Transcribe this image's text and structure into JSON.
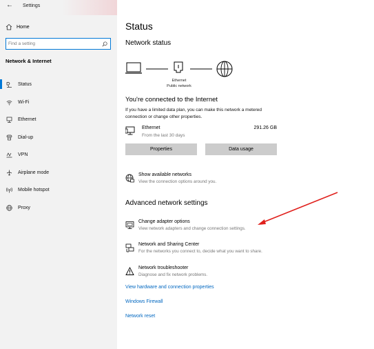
{
  "window": {
    "title": "Settings",
    "back_glyph": "←"
  },
  "sidebar": {
    "home_label": "Home",
    "search_placeholder": "Find a setting",
    "section_title": "Network & Internet",
    "items": [
      {
        "label": "Status",
        "icon": "status-icon",
        "active": true
      },
      {
        "label": "Wi-Fi",
        "icon": "wifi-icon"
      },
      {
        "label": "Ethernet",
        "icon": "ethernet-icon"
      },
      {
        "label": "Dial-up",
        "icon": "dialup-icon"
      },
      {
        "label": "VPN",
        "icon": "vpn-icon"
      },
      {
        "label": "Airplane mode",
        "icon": "airplane-icon"
      },
      {
        "label": "Mobile hotspot",
        "icon": "hotspot-icon"
      },
      {
        "label": "Proxy",
        "icon": "globe-icon"
      }
    ]
  },
  "main": {
    "title": "Status",
    "network_status_heading": "Network status",
    "diagram": {
      "line1": "Ethernet",
      "line2": "Public network"
    },
    "connected_title": "You're connected to the Internet",
    "connected_desc": "If you have a limited data plan, you can make this network a metered connection or change other properties.",
    "ethernet": {
      "name": "Ethernet",
      "sub": "From the last 30 days",
      "usage": "291.26 GB"
    },
    "buttons": {
      "properties": "Properties",
      "data_usage": "Data usage"
    },
    "show_networks": {
      "title": "Show available networks",
      "sub": "View the connection options around you."
    },
    "advanced_heading": "Advanced network settings",
    "advanced": [
      {
        "title": "Change adapter options",
        "sub": "View network adapters and change connection settings."
      },
      {
        "title": "Network and Sharing Center",
        "sub": "For the networks you connect to, decide what you want to share."
      },
      {
        "title": "Network troubleshooter",
        "sub": "Diagnose and fix network problems."
      }
    ],
    "links": {
      "hardware": "View hardware and connection properties",
      "firewall": "Windows Firewall",
      "reset": "Network reset"
    }
  },
  "colors": {
    "accent": "#0078d7",
    "link": "#0067c0",
    "annotation_arrow": "#e0201c",
    "sidebar_bg": "#f2f2f2"
  }
}
